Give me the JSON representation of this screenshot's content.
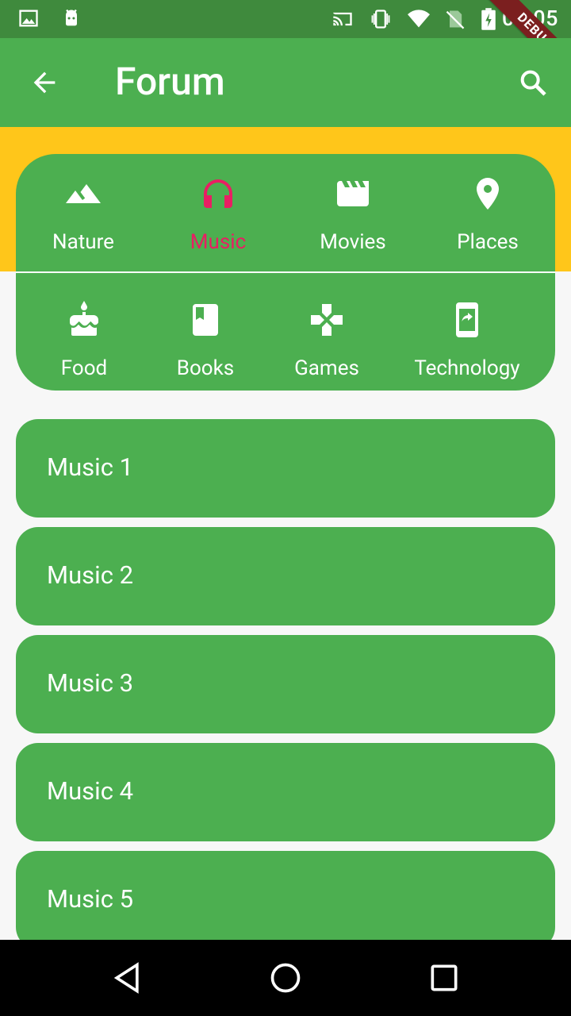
{
  "status_bar": {
    "time": "00:05",
    "left_icons": [
      "image-icon",
      "android-icon"
    ],
    "right_icons": [
      "cast-icon",
      "vibrate-icon",
      "wifi-icon",
      "no-sim-icon",
      "battery-charging-icon"
    ]
  },
  "debug_banner": "DEBUG",
  "app_bar": {
    "title": "Forum",
    "back_icon": "arrow-back-icon",
    "search_icon": "search-icon"
  },
  "categories": {
    "selected": "Music",
    "items": [
      {
        "label": "Nature",
        "icon": "terrain-icon"
      },
      {
        "label": "Music",
        "icon": "headphones-icon"
      },
      {
        "label": "Movies",
        "icon": "movie-icon"
      },
      {
        "label": "Places",
        "icon": "place-icon"
      },
      {
        "label": "Food",
        "icon": "cake-icon"
      },
      {
        "label": "Books",
        "icon": "book-icon"
      },
      {
        "label": "Games",
        "icon": "gamepad-icon"
      },
      {
        "label": "Technology",
        "icon": "phone-share-icon"
      }
    ]
  },
  "list": {
    "items": [
      "Music 1",
      "Music 2",
      "Music 3",
      "Music 4",
      "Music 5"
    ]
  },
  "nav_bar": {
    "buttons": [
      "back-triangle-icon",
      "home-circle-icon",
      "recents-square-icon"
    ]
  },
  "colors": {
    "primary": "#4caf50",
    "status_bar": "#3f8a3d",
    "accent_yellow": "#ffc61a",
    "selected": "#e91e63",
    "debug": "#7b1f1f"
  }
}
